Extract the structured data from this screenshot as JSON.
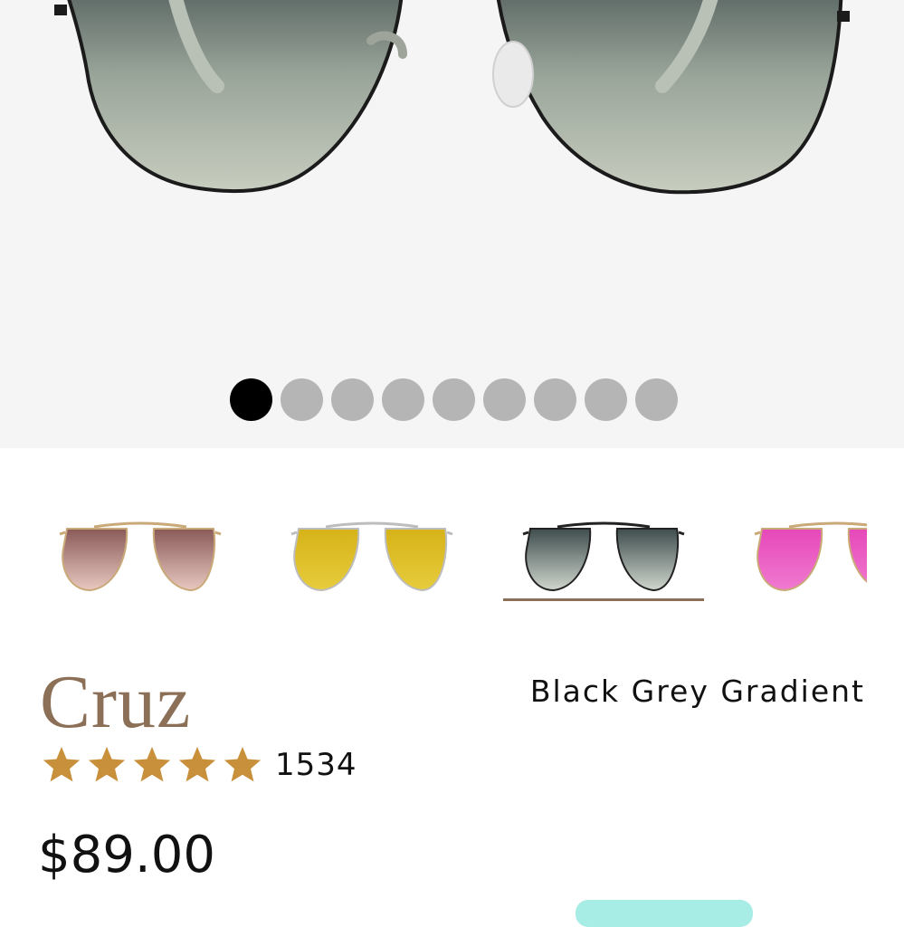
{
  "hero": {
    "image": "black-grey-gradient-aviator-closeup",
    "carousel": {
      "total": 9,
      "active": 0
    }
  },
  "swatches": [
    {
      "name": "brown-gradient",
      "frame": "#c9a978",
      "lens_top": "#8a5a58",
      "lens_bottom": "#e8c8c0",
      "selected": false
    },
    {
      "name": "yellow-mirror",
      "frame": "#bdbdbd",
      "lens_top": "#d6b218",
      "lens_bottom": "#e7cc3c",
      "selected": false
    },
    {
      "name": "black-grey-gradient",
      "frame": "#222222",
      "lens_top": "#3f4d4e",
      "lens_bottom": "#cfd6cc",
      "selected": true
    },
    {
      "name": "pink-mirror",
      "frame": "#c9a978",
      "lens_top": "#e648b9",
      "lens_bottom": "#f07ad0",
      "selected": false
    }
  ],
  "product": {
    "name": "Cruz",
    "variant": "Black Grey Gradient",
    "rating": 5,
    "review_count": "1534",
    "price": "$89.00"
  },
  "colors": {
    "accent": "#8b6f57",
    "star": "#c9903c",
    "badge": "#a8ece6"
  }
}
